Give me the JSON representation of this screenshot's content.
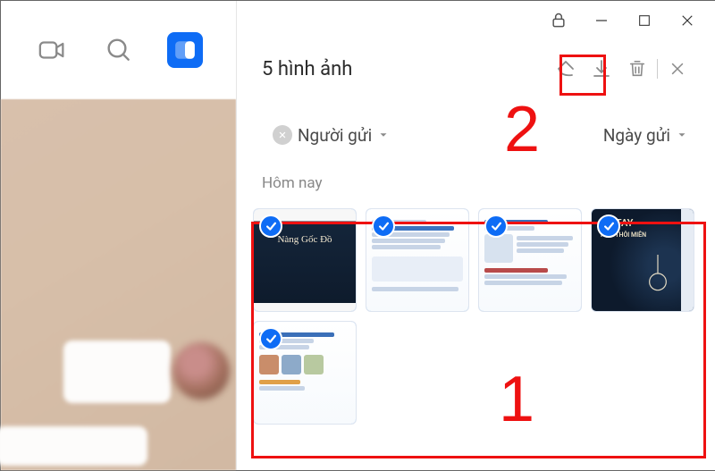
{
  "header": {
    "title": "5 hình ảnh"
  },
  "filters": {
    "sender_label": "Người gửi",
    "date_label": "Ngày gửi"
  },
  "section_today": "Hôm nay",
  "annotations": {
    "step1": "1",
    "step2": "2"
  },
  "thumbs": [
    {
      "title": "Nàng Gốc Đồ",
      "sub": ""
    },
    {
      "title": "",
      "sub": ""
    },
    {
      "title": "",
      "sub": ""
    },
    {
      "title": "SỐ TAY",
      "sub": "NHÀ THÔI MIÊN"
    },
    {
      "title": "",
      "sub": ""
    }
  ]
}
